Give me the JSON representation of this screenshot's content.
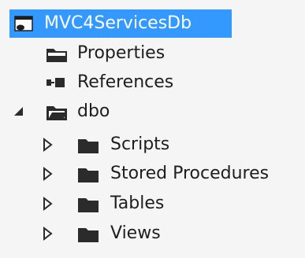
{
  "tree": {
    "root": {
      "label": "MVC4ServicesDb",
      "icon": "database-project-icon",
      "selected": true
    },
    "items": [
      {
        "label": "Properties",
        "icon": "properties-folder-icon"
      },
      {
        "label": "References",
        "icon": "references-icon"
      },
      {
        "label": "dbo",
        "icon": "open-folder-icon",
        "expanded": true
      },
      {
        "label": "Scripts",
        "icon": "folder-icon",
        "expanded": false
      },
      {
        "label": "Stored Procedures",
        "icon": "folder-icon",
        "expanded": false
      },
      {
        "label": "Tables",
        "icon": "folder-icon",
        "expanded": false
      },
      {
        "label": "Views",
        "icon": "folder-icon",
        "expanded": false
      }
    ]
  },
  "colors": {
    "selection": "#3399ff",
    "background": "#f5f5f5",
    "text": "#1e1e1e",
    "icon": "#2b2b2b"
  }
}
